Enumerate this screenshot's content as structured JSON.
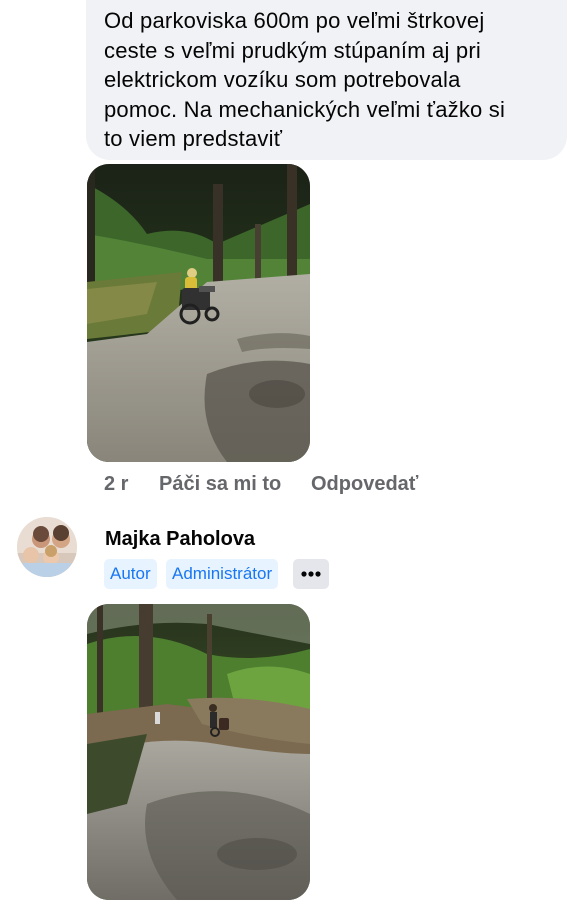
{
  "comment": {
    "lines": [
      "Od parkoviska 600m po veľmi štrkovej",
      "ceste s veľmi prudkým stúpaním aj pri",
      "elektrickom vozíku som potrebovala",
      "pomoc. Na mechanických veľmi ťažko si",
      "to viem predstaviť"
    ],
    "time": "2 r",
    "like_label": "Páči sa mi to",
    "reply_label": "Odpovedať"
  },
  "reply": {
    "author": "Majka Paholova",
    "badges": [
      "Autor",
      "Administrátor"
    ],
    "more_icon": "more-horizontal-icon"
  },
  "colors": {
    "bubble": "#f0f2f5",
    "badge_bg": "#e7f3ff",
    "badge_text": "#1877f2",
    "meta_text": "#65676b"
  }
}
